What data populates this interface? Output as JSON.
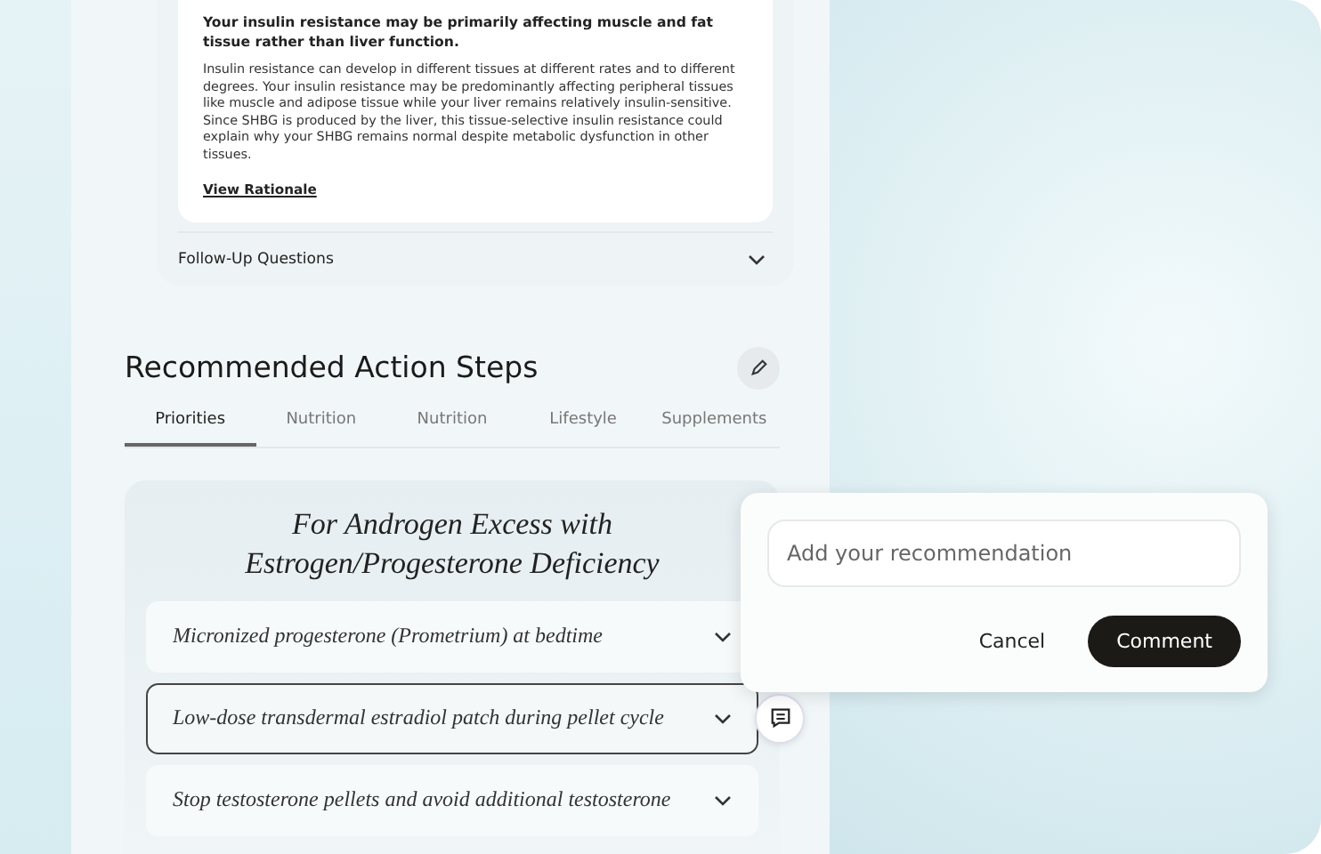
{
  "insight": {
    "headline": "Your insulin resistance may be primarily affecting muscle and fat tissue rather than liver function.",
    "body": "Insulin resistance can develop in different tissues at different rates and to different degrees. Your insulin resistance may be predominantly affecting peripheral tissues like muscle and adipose tissue while your liver remains relatively insulin-sensitive. Since SHBG is produced by the liver, this tissue-selective insulin resistance could explain why your SHBG remains normal despite metabolic dysfunction in other tissues.",
    "link": "View Rationale"
  },
  "follow_up": {
    "label": "Follow-Up Questions",
    "expanded": false
  },
  "section": {
    "title": "Recommended Action Steps"
  },
  "tabs": [
    {
      "label": "Priorities",
      "selected": true
    },
    {
      "label": "Nutrition",
      "selected": false
    },
    {
      "label": "Nutrition",
      "selected": false
    },
    {
      "label": "Lifestyle",
      "selected": false
    },
    {
      "label": "Supplements",
      "selected": false
    }
  ],
  "plan": {
    "title": "For Androgen Excess with Estrogen/Progesterone Deficiency",
    "items": [
      {
        "label": "Micronized progesterone (Prometrium) at bedtime",
        "selected": false
      },
      {
        "label": "Low-dose transdermal estradiol patch during pellet cycle",
        "selected": true
      },
      {
        "label": "Stop testosterone pellets and avoid additional testosterone",
        "selected": false
      }
    ]
  },
  "comment_popover": {
    "placeholder": "Add your recommendation",
    "buttons": [
      "Cancel",
      "Comment"
    ]
  }
}
